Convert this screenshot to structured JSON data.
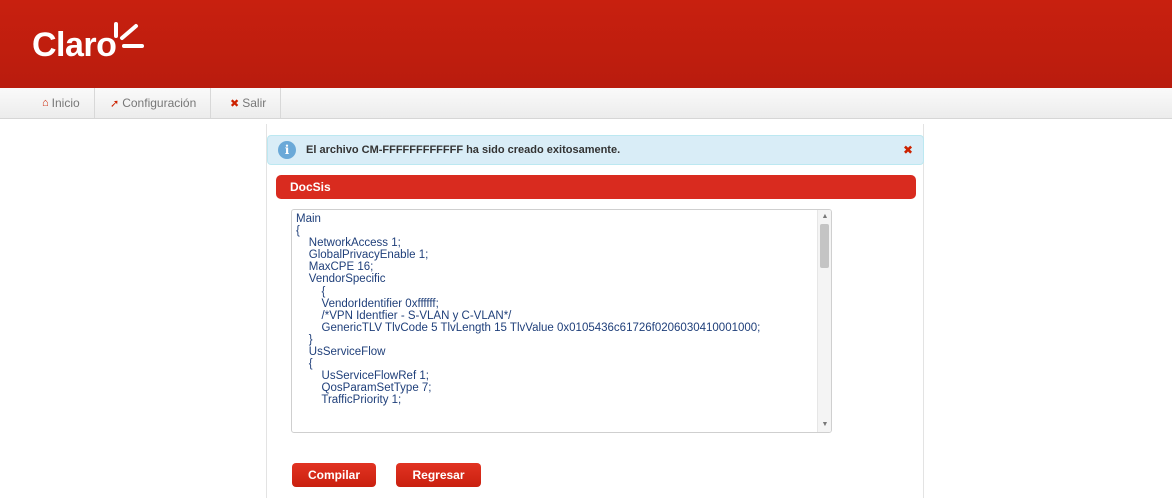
{
  "brand": {
    "logo_text": "Claro",
    "color_primary": "#c8200f",
    "color_accent": "#d92b1f"
  },
  "nav": {
    "items": [
      {
        "label": "Inicio",
        "icon": "home-icon"
      },
      {
        "label": "Configuración",
        "icon": "wrench-icon"
      },
      {
        "label": "Salir",
        "icon": "close-icon"
      }
    ]
  },
  "alert": {
    "message": "El archivo CM-FFFFFFFFFFFF ha sido creado exitosamente.",
    "icon": "info-icon",
    "close_label": "✖"
  },
  "section": {
    "title": "DocSis"
  },
  "editor": {
    "lines": [
      "Main",
      "{",
      "    NetworkAccess 1;",
      "    GlobalPrivacyEnable 1;",
      "    MaxCPE 16;",
      "    VendorSpecific",
      "        {",
      "        VendorIdentifier 0xffffff;",
      "        /*VPN Identfier - S-VLAN y C-VLAN*/",
      "        GenericTLV TlvCode 5 TlvLength 15 TlvValue 0x0105436c61726f0206030410001000;",
      "    }",
      "    UsServiceFlow",
      "    {",
      "        UsServiceFlowRef 1;",
      "        QosParamSetType 7;",
      "        TrafficPriority 1;"
    ]
  },
  "buttons": {
    "compile_label": "Compilar",
    "back_label": "Regresar"
  }
}
